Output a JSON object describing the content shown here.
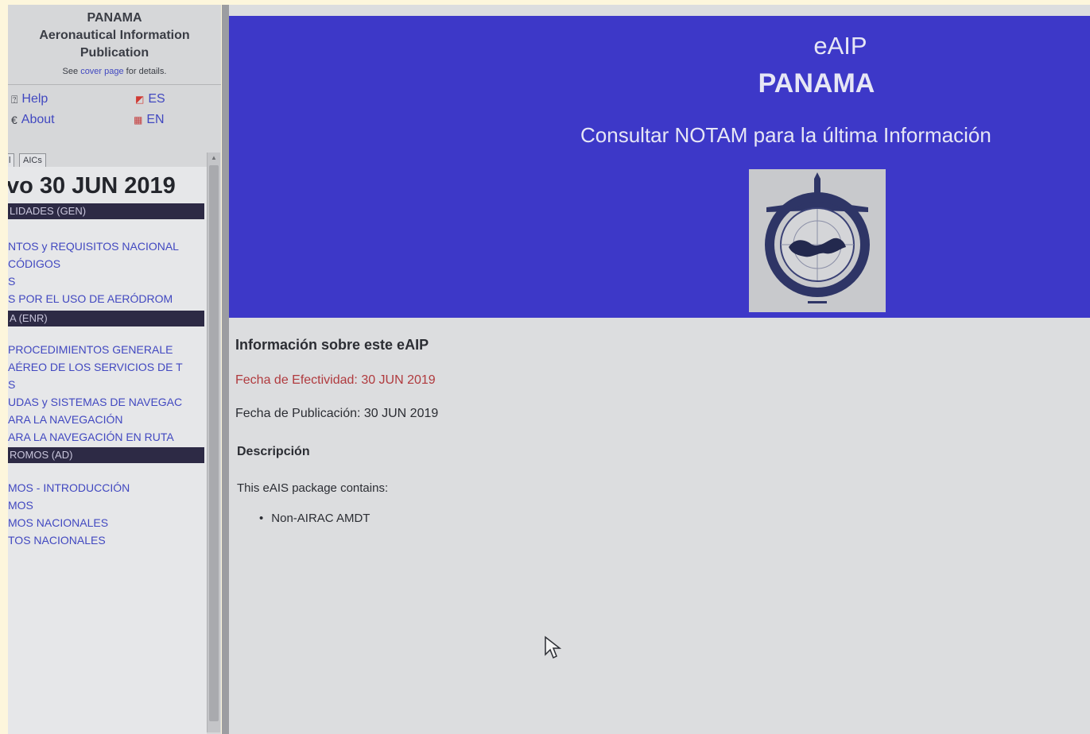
{
  "sidebar": {
    "title_line1": "PANAMA",
    "title_line2": "Aeronautical Information",
    "title_line3": "Publication",
    "see_prefix": "See ",
    "see_link": "cover page",
    "see_suffix": " for details.",
    "help_label": "Help",
    "about_label": "About",
    "lang_es": "ES",
    "lang_en": "EN",
    "tab_first": "l",
    "tab_aics": "AICs",
    "effective_heading": "vo 30 JUN 2019",
    "sections": [
      {
        "heading": "LIDADES (GEN)",
        "items": [
          "NTOS y REQUISITOS NACIONAL",
          "CÓDIGOS",
          "S",
          "S POR EL USO DE AERÓDROM"
        ]
      },
      {
        "heading": "A (ENR)",
        "items": [
          "PROCEDIMIENTOS GENERALE",
          "AÉREO DE LOS SERVICIOS DE T",
          "S",
          "UDAS y SISTEMAS DE NAVEGAC",
          "ARA LA NAVEGACIÓN",
          "ARA LA NAVEGACIÓN EN RUTA"
        ]
      },
      {
        "heading": "ROMOS (AD)",
        "items": [
          "MOS - INTRODUCCIÓN",
          "MOS",
          "MOS NACIONALES",
          "TOS NACIONALES"
        ]
      }
    ]
  },
  "header": {
    "line1": "eAIP",
    "line2": "PANAMA",
    "notice": "Consultar NOTAM para la última Información",
    "logo_icon": "aviation-authority-seal-icon"
  },
  "main": {
    "info_title": "Información sobre este eAIP",
    "effective_date": "Fecha de Efectividad: 30 JUN 2019",
    "publication_date": "Fecha de Publicación: 30 JUN 2019",
    "description_title": "Descripción",
    "description_text": "This eAIS package contains:",
    "bullets": [
      "Non-AIRAC AMDT"
    ]
  },
  "colors": {
    "banner": "#3d38c8",
    "link": "#4148c0",
    "section_bar": "#2d2a45",
    "effective_date": "#b03a3e"
  }
}
